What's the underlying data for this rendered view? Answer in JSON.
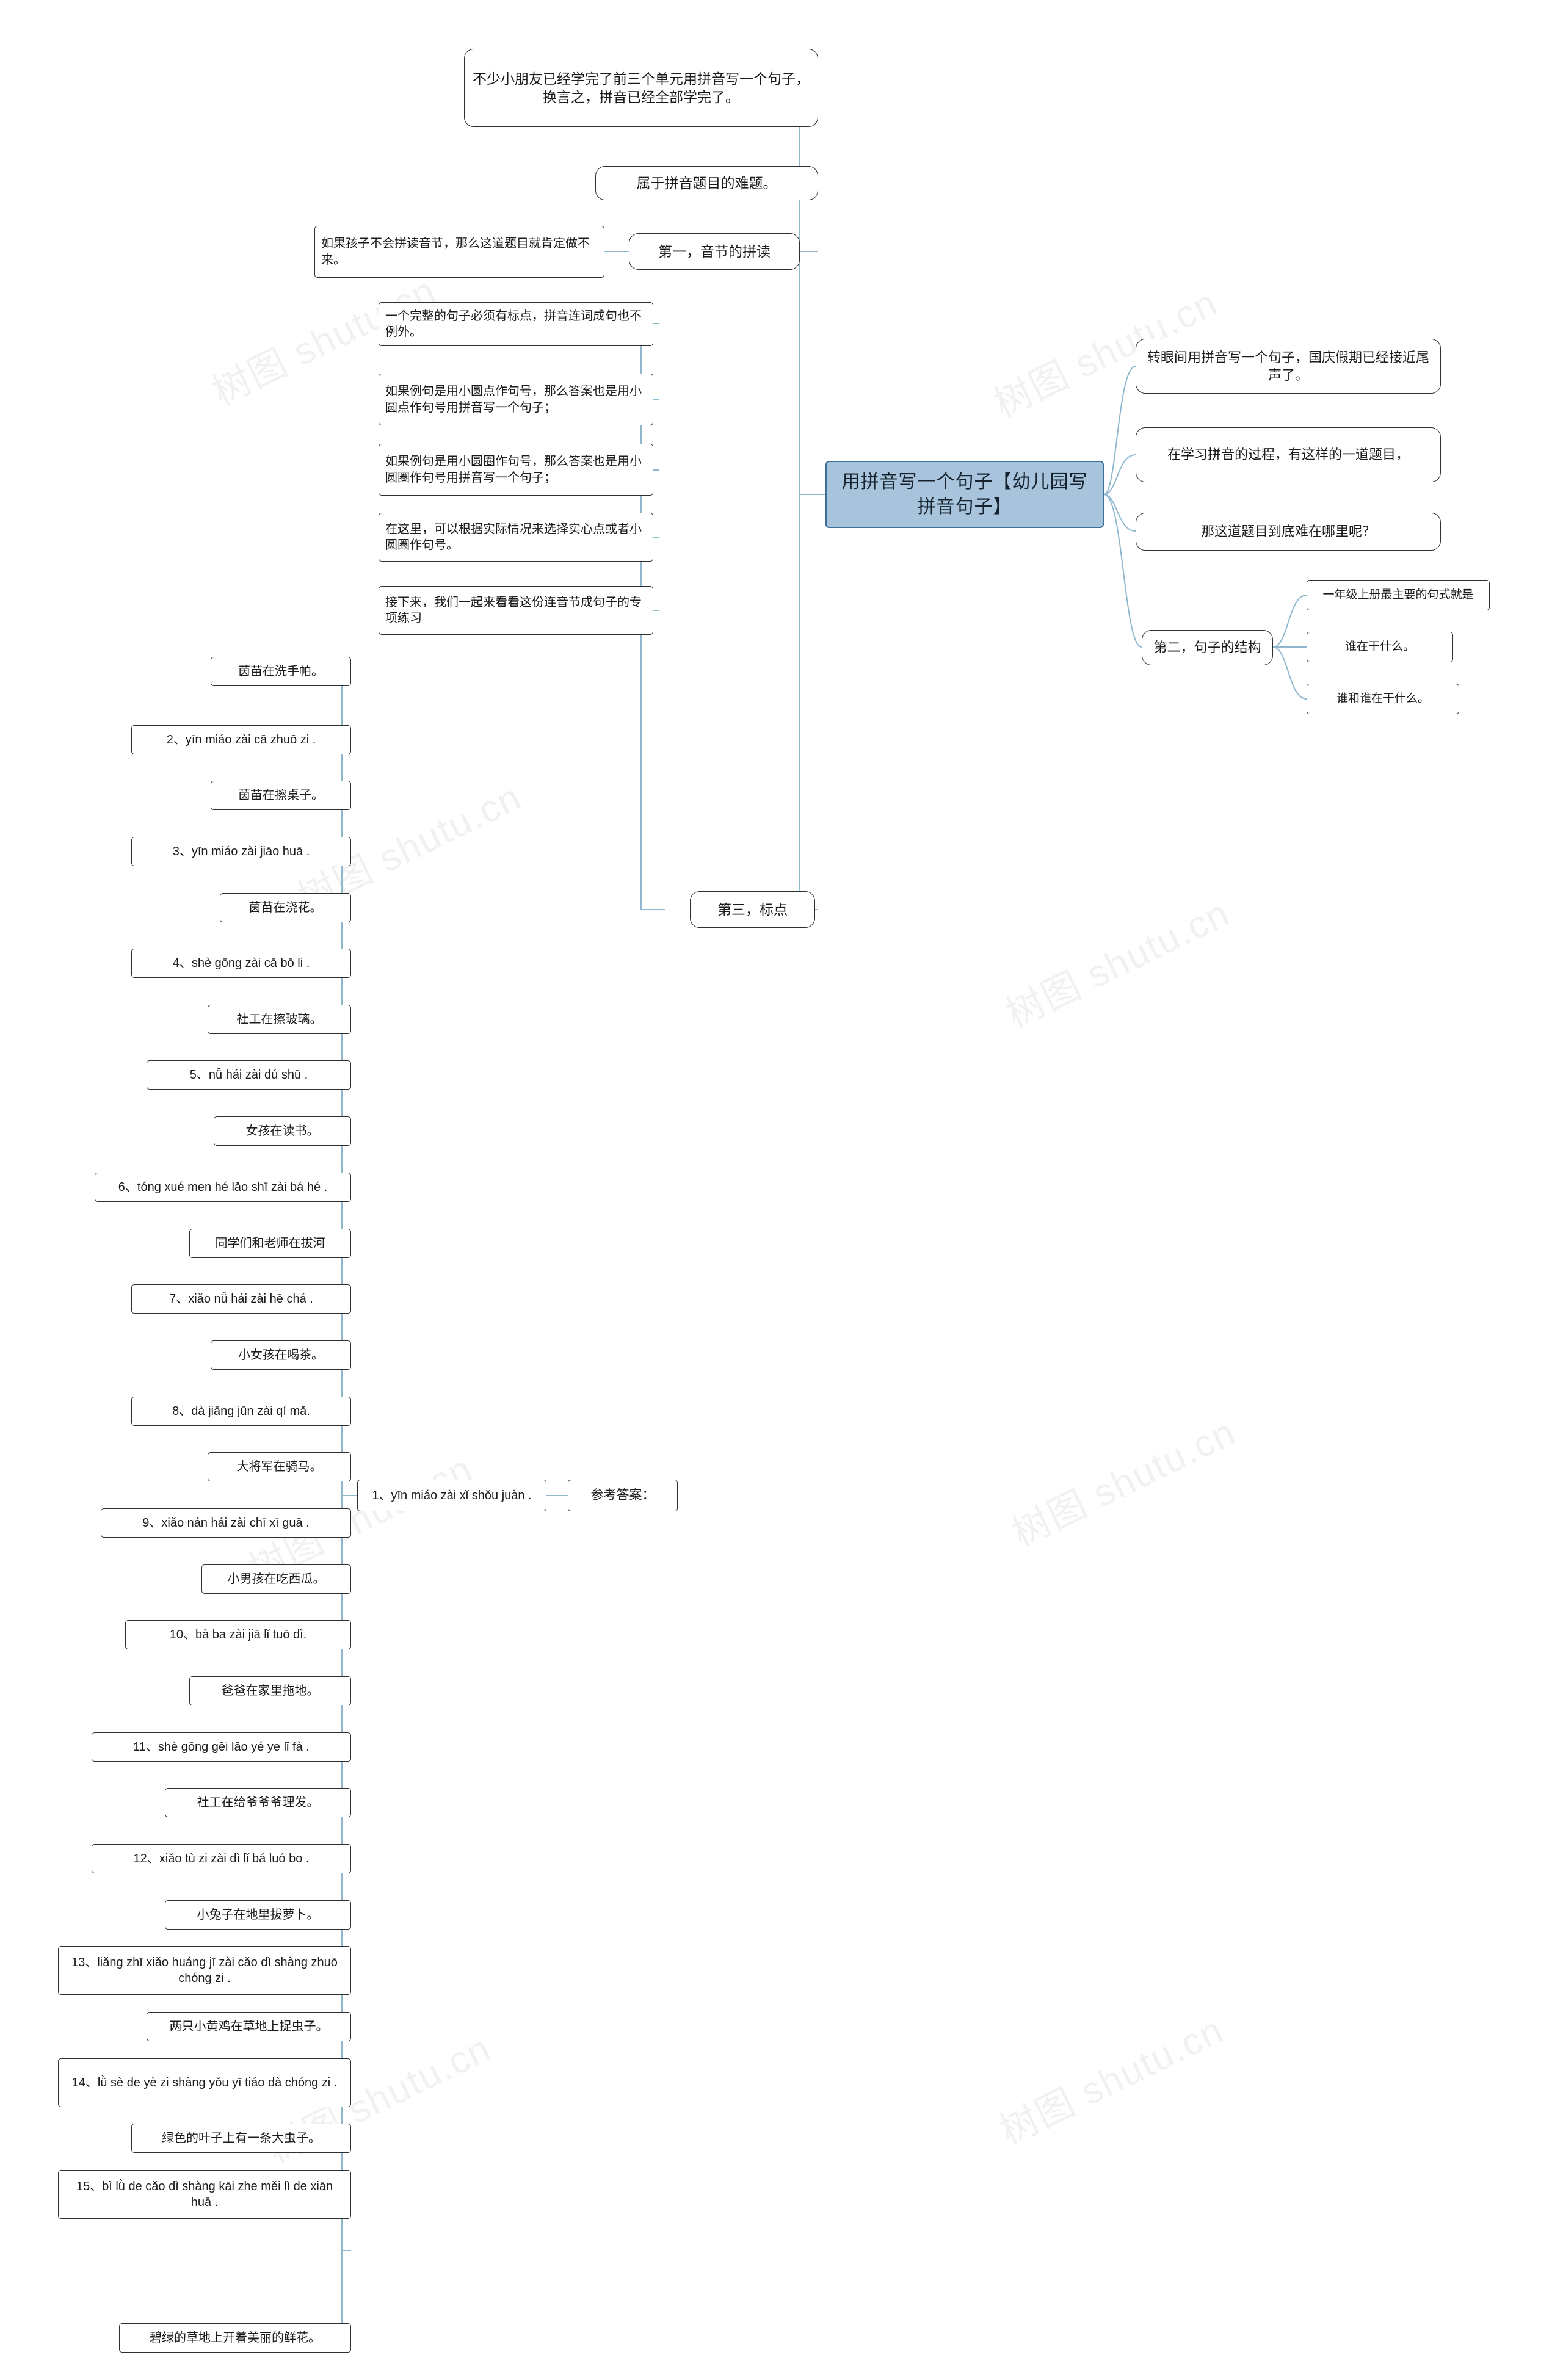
{
  "diagram": {
    "type": "mindmap",
    "root": {
      "label": "用拼音写一个句子【幼儿园写拼音句子】"
    },
    "watermarks": [
      "树图 shutu.cn",
      "树图 shutu.cn",
      "树图 shutu.cn",
      "树图 shutu.cn",
      "树图 shutu.cn",
      "树图 shutu.cn",
      "树图 shutu.cn",
      "树图 shutu.cn"
    ],
    "right_branch": [
      {
        "label": "转眼间用拼音写一个句子，国庆假期已经接近尾声了。"
      },
      {
        "label": "在学习拼音的过程，有这样的一道题目，"
      },
      {
        "label": "那这道题目到底难在哪里呢？"
      },
      {
        "label": "第二，句子的结构",
        "children": [
          {
            "label": "一年级上册最主要的句式就是"
          },
          {
            "label": "谁在干什么。"
          },
          {
            "label": "谁和谁在干什么。"
          }
        ]
      }
    ],
    "top_branch": [
      {
        "label": "不少小朋友已经学完了前三个单元用拼音写一个句子，换言之，拼音已经全部学完了。"
      },
      {
        "label": "属于拼音题目的难题。"
      },
      {
        "label": "第一，音节的拼读",
        "children": [
          {
            "label": "如果孩子不会拼读音节，那么这道题目就肯定做不来。"
          }
        ]
      }
    ],
    "punctuation_group": [
      {
        "label": "一个完整的句子必须有标点，拼音连词成句也不例外。"
      },
      {
        "label": "如果例句是用小圆点作句号，那么答案也是用小圆点作句号用拼音写一个句子；"
      },
      {
        "label": "如果例句是用小圆圈作句号，那么答案也是用小圆圈作句号用拼音写一个句子；"
      },
      {
        "label": "在这里，可以根据实际情况来选择实心点或者小圆圈作句号。"
      },
      {
        "label": "接下来，我们一起来看看这份连音节成句子的专项练习"
      }
    ],
    "third_node": {
      "label": "第三，标点"
    },
    "answer_label": {
      "label": "参考答案："
    },
    "answer_head": {
      "label": "1、yīn miáo zài xǐ shǒu juàn ."
    },
    "answers": [
      "茵苗在洗手帕。",
      "2、yīn miáo zài cā zhuō zi .",
      "茵苗在擦桌子。",
      "3、yīn miáo zài jiāo huā .",
      "茵苗在浇花。",
      "4、shè gōng zài cā bō li .",
      "社工在擦玻璃。",
      "5、nǚ hái zài dú shū .",
      "女孩在读书。",
      "6、tóng xué men hé lǎo shī zài bá hé .",
      "同学们和老师在拔河",
      "7、xiǎo nǚ hái zài hē chá .",
      "小女孩在喝茶。",
      "8、dà jiāng jūn zài qí mǎ.",
      "大将军在骑马。",
      "9、xiǎo nán hái zài chī xī guā .",
      "小男孩在吃西瓜。",
      "10、bà ba zài jiā lǐ tuō dì.",
      "爸爸在家里拖地。",
      "11、shè gōng gěi lǎo yé ye lǐ fà .",
      "社工在给爷爷爷理发。",
      "12、xiǎo tù zi zài dì lǐ bá luó bo .",
      "小兔子在地里拔萝卜。",
      "13、liǎng zhī xiǎo huáng jī zài cǎo dì shàng zhuō chóng zi .",
      "两只小黄鸡在草地上捉虫子。",
      "14、lǜ sè de yè zi shàng yǒu yī tiáo dà chóng zi .",
      "绿色的叶子上有一条大虫子。",
      "15、bì lǜ de cǎo dì shàng kāi zhe měi lì de xiān huā .",
      "碧绿的草地上开着美丽的鲜花。"
    ]
  }
}
